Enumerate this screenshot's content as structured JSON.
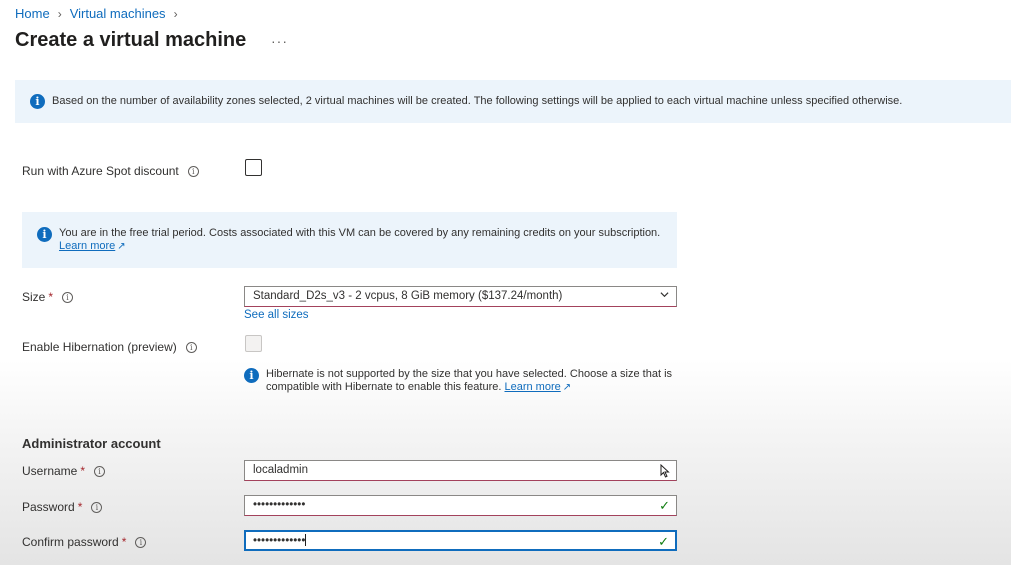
{
  "breadcrumb": {
    "home": "Home",
    "virtual_machines": "Virtual machines"
  },
  "page": {
    "title": "Create a virtual machine",
    "more": "···"
  },
  "zones_banner": {
    "text": "Based on the number of availability zones selected, 2 virtual machines will be created. The following settings will be applied to each virtual machine unless specified otherwise."
  },
  "spot": {
    "label": "Run with Azure Spot discount",
    "checked": false
  },
  "trial_banner": {
    "text": "You are in the free trial period. Costs associated with this VM can be covered by any remaining credits on your subscription.",
    "link": "Learn more"
  },
  "size": {
    "label": "Size",
    "required": "*",
    "value": "Standard_D2s_v3 - 2 vcpus, 8 GiB memory ($137.24/month)",
    "see_all": "See all sizes"
  },
  "hibernation": {
    "label": "Enable Hibernation (preview)",
    "checked": false,
    "disabled": true,
    "note_line1": "Hibernate is not supported by the size that you have selected. Choose a size that is",
    "note_line2": "compatible with Hibernate to enable this feature.",
    "link": "Learn more"
  },
  "admin": {
    "title": "Administrator account",
    "username_label": "Username",
    "username_value": "localadmin",
    "password_label": "Password",
    "password_value": "•••••••••••••",
    "confirm_label": "Confirm password",
    "confirm_value": "•••••••••••••",
    "required": "*"
  },
  "colors": {
    "accent": "#0f6cbd",
    "banner_bg": "#ecf4fb",
    "valid": "#107c10",
    "required": "#a4262c"
  }
}
